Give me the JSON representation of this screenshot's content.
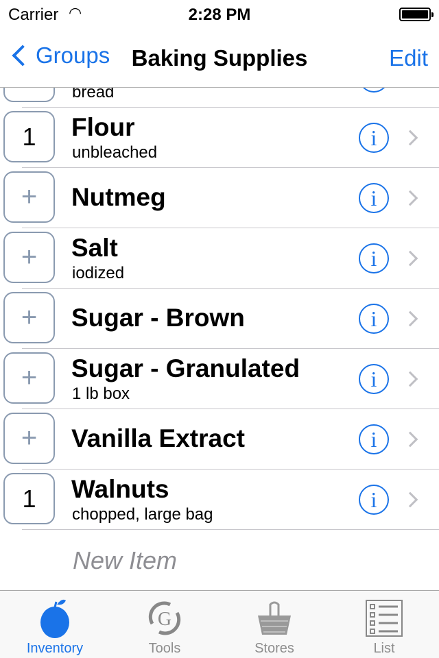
{
  "status": {
    "carrier": "Carrier",
    "time": "2:28 PM"
  },
  "nav": {
    "back_label": "Groups",
    "title": "Baking Supplies",
    "edit_label": "Edit"
  },
  "items": [
    {
      "qty": "",
      "name": "",
      "note": "bread"
    },
    {
      "qty": "1",
      "name": "Flour",
      "note": "unbleached"
    },
    {
      "qty": "+",
      "name": "Nutmeg",
      "note": ""
    },
    {
      "qty": "+",
      "name": "Salt",
      "note": "iodized"
    },
    {
      "qty": "+",
      "name": "Sugar - Brown",
      "note": ""
    },
    {
      "qty": "+",
      "name": "Sugar - Granulated",
      "note": "1 lb box"
    },
    {
      "qty": "+",
      "name": "Vanilla Extract",
      "note": ""
    },
    {
      "qty": "1",
      "name": "Walnuts",
      "note": "chopped, large bag"
    }
  ],
  "new_item_placeholder": "New Item",
  "tabs": [
    {
      "label": "Inventory",
      "icon": "apple-icon",
      "active": true
    },
    {
      "label": "Tools",
      "icon": "g-refresh-icon"
    },
    {
      "label": "Stores",
      "icon": "basket-icon"
    },
    {
      "label": "List",
      "icon": "checklist-icon"
    }
  ],
  "colors": {
    "accent": "#1a73e8",
    "inactive": "#8e8e8e"
  }
}
